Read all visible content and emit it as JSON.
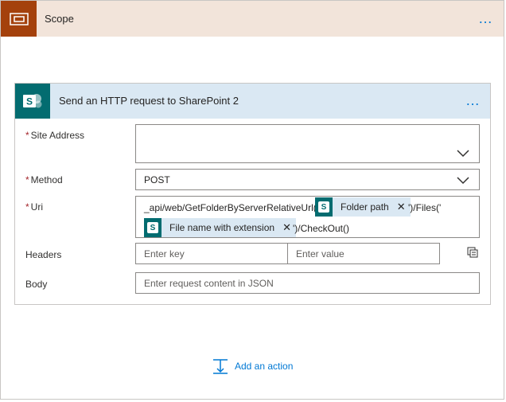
{
  "scope": {
    "title": "Scope",
    "more_label": "…",
    "icon": "scope-icon"
  },
  "action": {
    "title": "Send an HTTP request to SharePoint 2",
    "more_label": "…",
    "icon": "sharepoint-icon",
    "fields": {
      "site_address": {
        "label": "Site Address",
        "required": "*",
        "value": ""
      },
      "method": {
        "label": "Method",
        "required": "*",
        "value": "POST"
      },
      "uri": {
        "label": "Uri",
        "required": "*",
        "text_before": "_api/web/GetFolderByServerRelativeUrl('",
        "token1": "Folder path",
        "text_middle": "')/Files('",
        "token2": "File name with extension",
        "text_after": "')/CheckOut()"
      },
      "headers": {
        "label": "Headers",
        "key_placeholder": "Enter key",
        "value_placeholder": "Enter value"
      },
      "body": {
        "label": "Body",
        "placeholder": "Enter request content in JSON"
      }
    }
  },
  "add_action": {
    "label": "Add an action"
  },
  "colors": {
    "scope_accent": "#a4410c",
    "scope_header_bg": "#f2e4da",
    "sharepoint": "#036c70",
    "action_header_bg": "#dae8f3",
    "link": "#0078d4",
    "required": "#a4262c"
  }
}
